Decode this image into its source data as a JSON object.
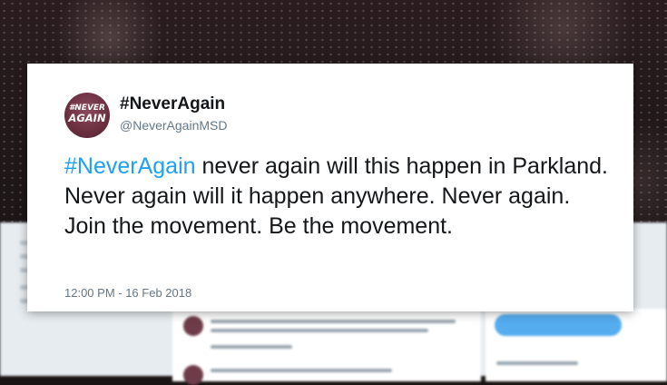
{
  "tweet": {
    "display_name": "#NeverAgain",
    "handle": "@NeverAgainMSD",
    "avatar_text_line1": "#NEVER",
    "avatar_text_line2": "AGAIN",
    "text_hashtag": "#NeverAgain",
    "text_body": " never again will this happen in Parkland. Never again will it happen anywhere. Never again. Join the movement. Be the movement.",
    "timestamp": "12:00 PM - 16 Feb 2018"
  },
  "colors": {
    "hashtag": "#1da1f2",
    "text": "#14171a",
    "secondary_text": "#657786",
    "avatar_bg": "#6b2f3f",
    "background_button": "#55acee"
  }
}
